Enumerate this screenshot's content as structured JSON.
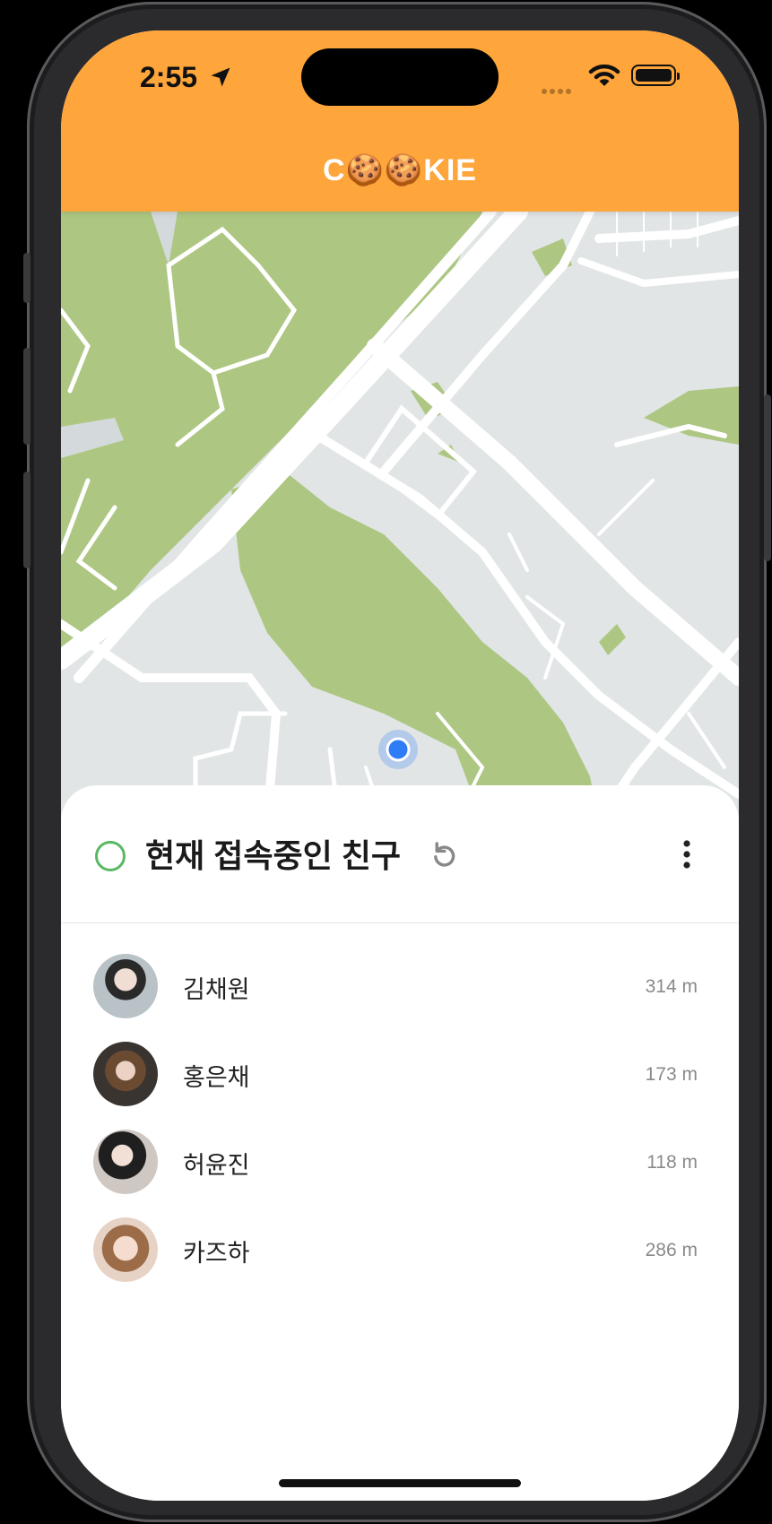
{
  "status_bar": {
    "time": "2:55"
  },
  "header": {
    "title": "C🍪🍪KIE",
    "background": "#fea53b"
  },
  "map": {
    "park_color": "#adc783",
    "land_color": "#e1e5e6",
    "road_color": "#ffffff",
    "user_location_color": "#2f7df6"
  },
  "online_panel": {
    "title": "현재 접속중인 친구",
    "status_color": "#5ab762",
    "friends": [
      {
        "name": "김채원",
        "distance": "314 m"
      },
      {
        "name": "홍은채",
        "distance": "173 m"
      },
      {
        "name": "허윤진",
        "distance": "118 m"
      },
      {
        "name": "카즈하",
        "distance": "286 m"
      }
    ]
  }
}
